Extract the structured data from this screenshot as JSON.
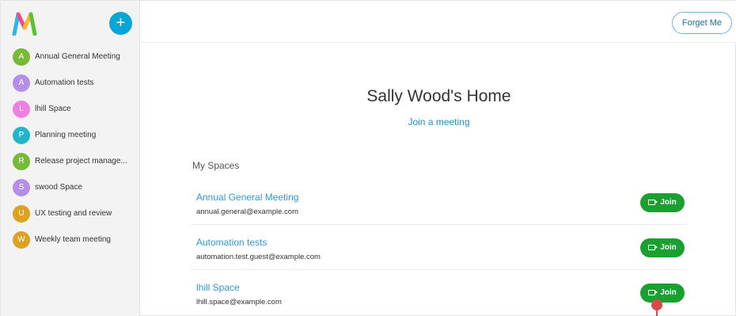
{
  "app": {
    "logo_icon": "m-logo-icon",
    "add_button_label": "+",
    "accent_color": "#07a5d8"
  },
  "sidebar": {
    "items": [
      {
        "initial": "A",
        "label": "Annual General Meeting",
        "color": "#79b93a"
      },
      {
        "initial": "A",
        "label": "Automation tests",
        "color": "#b48ee8"
      },
      {
        "initial": "L",
        "label": "lhill Space",
        "color": "#ef7fe0"
      },
      {
        "initial": "P",
        "label": "Planning meeting",
        "color": "#24b4c8"
      },
      {
        "initial": "R",
        "label": "Release project manage...",
        "color": "#79b93a"
      },
      {
        "initial": "S",
        "label": "swood Space",
        "color": "#b48ee8"
      },
      {
        "initial": "U",
        "label": "UX testing and review",
        "color": "#dda223"
      },
      {
        "initial": "W",
        "label": "Weekly team meeting",
        "color": "#dda223"
      }
    ]
  },
  "header": {
    "forget_label": "Forget Me"
  },
  "main": {
    "title": "Sally Wood's Home",
    "join_meeting_label": "Join a meeting",
    "spaces_heading": "My Spaces",
    "join_button_label": "Join",
    "join_button_color": "#1aa030",
    "spaces": [
      {
        "title": "Annual General Meeting",
        "email": "annual.general@example.com"
      },
      {
        "title": "Automation tests",
        "email": "automation.test.guest@example.com"
      },
      {
        "title": "lhill Space",
        "email": "lhill.space@example.com"
      }
    ]
  }
}
